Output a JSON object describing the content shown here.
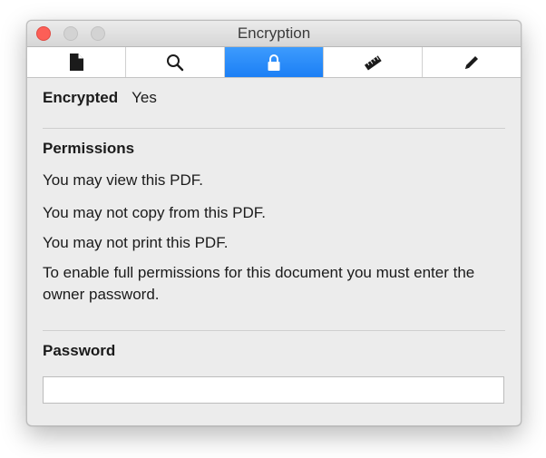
{
  "window": {
    "title": "Encryption"
  },
  "toolbar": {
    "tabs": [
      {
        "icon": "document-icon",
        "selected": false
      },
      {
        "icon": "search-icon",
        "selected": false
      },
      {
        "icon": "lock-icon",
        "selected": true
      },
      {
        "icon": "ruler-icon",
        "selected": false
      },
      {
        "icon": "pencil-icon",
        "selected": false
      }
    ],
    "accent_color": "#1f84f7"
  },
  "encryption": {
    "label": "Encrypted",
    "value": "Yes"
  },
  "permissions": {
    "heading": "Permissions",
    "lines": [
      "You may view this PDF.",
      "You may not copy from this PDF.",
      "You may not print this PDF.",
      "To enable full permissions for this document you must enter the owner password."
    ]
  },
  "password": {
    "heading": "Password",
    "value": "",
    "placeholder": ""
  }
}
